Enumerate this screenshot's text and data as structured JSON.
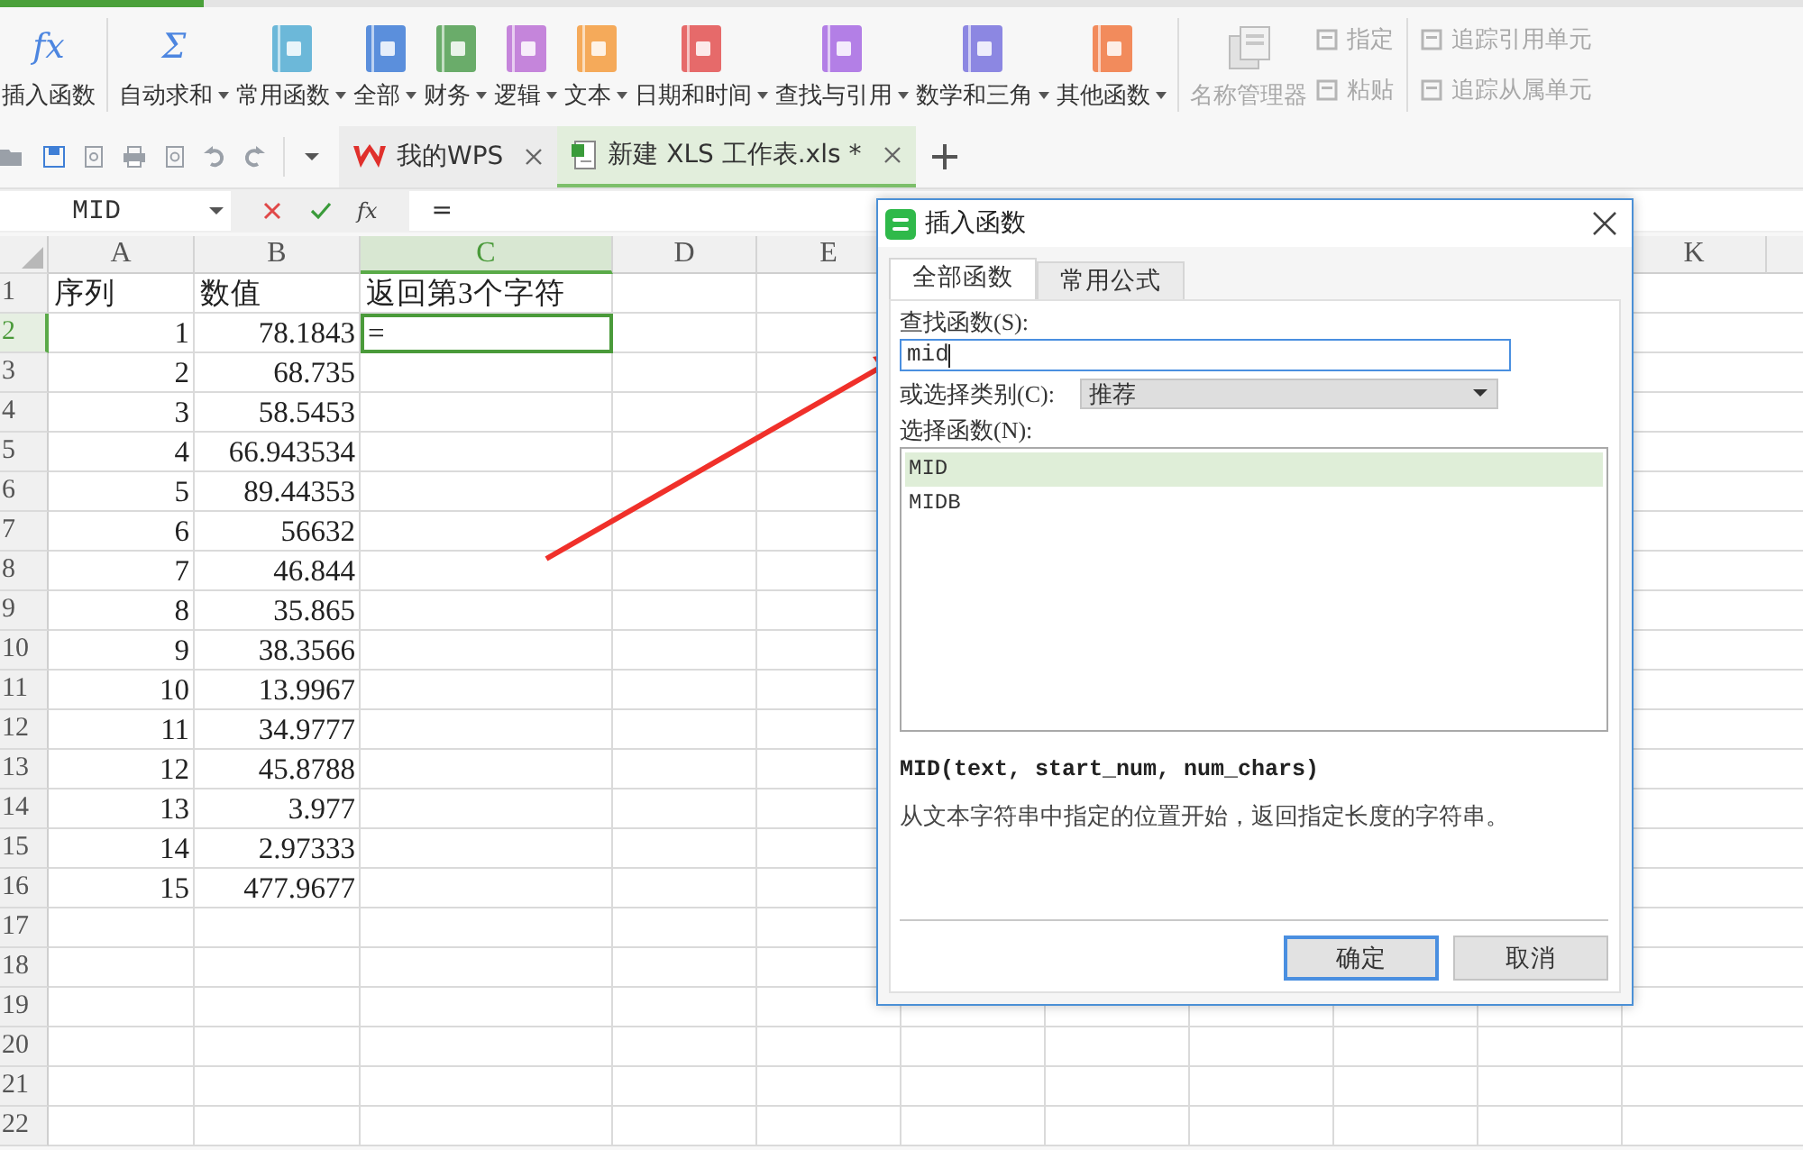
{
  "ribbon": {
    "groups": [
      {
        "large": [
          {
            "label": "插入函数",
            "kind": "glyph",
            "glyph": "fx",
            "dropdown": false,
            "disabled": false
          }
        ]
      },
      {
        "large": [
          {
            "label": "自动求和",
            "kind": "glyph",
            "glyph": "Σ",
            "dropdown": true,
            "disabled": false
          },
          {
            "label": "常用函数",
            "kind": "book",
            "color": "#6cb8d9",
            "dropdown": true,
            "disabled": false
          },
          {
            "label": "全部",
            "kind": "book",
            "color": "#5b8fdc",
            "dropdown": true,
            "disabled": false
          },
          {
            "label": "财务",
            "kind": "book",
            "color": "#6aac6a",
            "dropdown": true,
            "disabled": false
          },
          {
            "label": "逻辑",
            "kind": "book",
            "color": "#c585db",
            "dropdown": true,
            "disabled": false
          },
          {
            "label": "文本",
            "kind": "book",
            "color": "#f5aa5a",
            "dropdown": true,
            "disabled": false
          },
          {
            "label": "日期和时间",
            "kind": "book",
            "color": "#e66a6a",
            "dropdown": true,
            "disabled": false
          },
          {
            "label": "查找与引用",
            "kind": "book",
            "color": "#b37fe6",
            "dropdown": true,
            "disabled": false
          },
          {
            "label": "数学和三角",
            "kind": "book",
            "color": "#8c87e2",
            "dropdown": true,
            "disabled": false
          },
          {
            "label": "其他函数",
            "kind": "book",
            "color": "#f28b5c",
            "dropdown": true,
            "disabled": false
          }
        ]
      },
      {
        "large": [
          {
            "label": "名称管理器",
            "kind": "doc",
            "dropdown": false,
            "disabled": true
          }
        ],
        "small": [
          {
            "label": "指定",
            "disabled": true
          },
          {
            "label": "粘贴",
            "disabled": true
          }
        ]
      },
      {
        "small": [
          {
            "label": "追踪引用单元",
            "disabled": true
          },
          {
            "label": "追踪从属单元",
            "disabled": true
          }
        ]
      }
    ]
  },
  "doc_tabs": [
    {
      "label": "我的WPS",
      "kind": "wps",
      "selected": false
    },
    {
      "label": "新建 XLS 工作表.xls *",
      "kind": "sheet",
      "selected": true
    }
  ],
  "formula_bar": {
    "name_box": "MID",
    "function_glyph": "fx",
    "formula": "="
  },
  "sheet": {
    "columns_left": [
      {
        "label": "A",
        "selected": false
      },
      {
        "label": "B",
        "selected": false
      },
      {
        "label": "C",
        "selected": true
      },
      {
        "label": "D",
        "selected": false
      },
      {
        "label": "E",
        "selected": false
      }
    ],
    "columns_right": [
      {
        "label": "K",
        "selected": false
      }
    ],
    "rows": [
      {
        "number": "1",
        "kind": "text",
        "selected": false,
        "cells": [
          "序列",
          "数值",
          "返回第3个字符"
        ]
      },
      {
        "number": "2",
        "kind": "number",
        "selected": true,
        "cells": [
          "1",
          "78.1843",
          "="
        ]
      },
      {
        "number": "3",
        "kind": "number",
        "selected": false,
        "cells": [
          "2",
          "68.735"
        ]
      },
      {
        "number": "4",
        "kind": "number",
        "selected": false,
        "cells": [
          "3",
          "58.5453"
        ]
      },
      {
        "number": "5",
        "kind": "number",
        "selected": false,
        "cells": [
          "4",
          "66.943534"
        ]
      },
      {
        "number": "6",
        "kind": "number",
        "selected": false,
        "cells": [
          "5",
          "89.44353"
        ]
      },
      {
        "number": "7",
        "kind": "number",
        "selected": false,
        "cells": [
          "6",
          "56632"
        ]
      },
      {
        "number": "8",
        "kind": "number",
        "selected": false,
        "cells": [
          "7",
          "46.844"
        ]
      },
      {
        "number": "9",
        "kind": "number",
        "selected": false,
        "cells": [
          "8",
          "35.865"
        ]
      },
      {
        "number": "10",
        "kind": "number",
        "selected": false,
        "cells": [
          "9",
          "38.3566"
        ]
      },
      {
        "number": "11",
        "kind": "number",
        "selected": false,
        "cells": [
          "10",
          "13.9967"
        ]
      },
      {
        "number": "12",
        "kind": "number",
        "selected": false,
        "cells": [
          "11",
          "34.9777"
        ]
      },
      {
        "number": "13",
        "kind": "number",
        "selected": false,
        "cells": [
          "12",
          "45.8788"
        ]
      },
      {
        "number": "14",
        "kind": "number",
        "selected": false,
        "cells": [
          "13",
          "3.977"
        ]
      },
      {
        "number": "15",
        "kind": "number",
        "selected": false,
        "cells": [
          "14",
          "2.97333"
        ]
      },
      {
        "number": "16",
        "kind": "number",
        "selected": false,
        "cells": [
          "15",
          "477.9677"
        ]
      },
      {
        "number": "17",
        "kind": "number",
        "selected": false,
        "cells": []
      },
      {
        "number": "18",
        "kind": "number",
        "selected": false,
        "cells": []
      },
      {
        "number": "19",
        "kind": "number",
        "selected": false,
        "cells": []
      },
      {
        "number": "20",
        "kind": "number",
        "selected": false,
        "cells": []
      },
      {
        "number": "21",
        "kind": "number",
        "selected": false,
        "cells": []
      },
      {
        "number": "22",
        "kind": "number",
        "selected": false,
        "cells": []
      }
    ]
  },
  "dialog": {
    "title": "插入函数",
    "tabs": [
      {
        "label": "全部函数",
        "selected": true
      },
      {
        "label": "常用公式",
        "selected": false
      }
    ],
    "search_label": "查找函数(S):",
    "search_value": "mid",
    "category_label": "或选择类别(C):",
    "category_value": "推荐",
    "list_label": "选择函数(N):",
    "functions": [
      {
        "name": "MID",
        "selected": true
      },
      {
        "name": "MIDB",
        "selected": false
      }
    ],
    "syntax": "MID(text, start_num, num_chars)",
    "description": "从文本字符串中指定的位置开始，返回指定长度的字符串。",
    "buttons": [
      {
        "label": "确定",
        "default": true
      },
      {
        "label": "取消",
        "default": false
      }
    ]
  }
}
